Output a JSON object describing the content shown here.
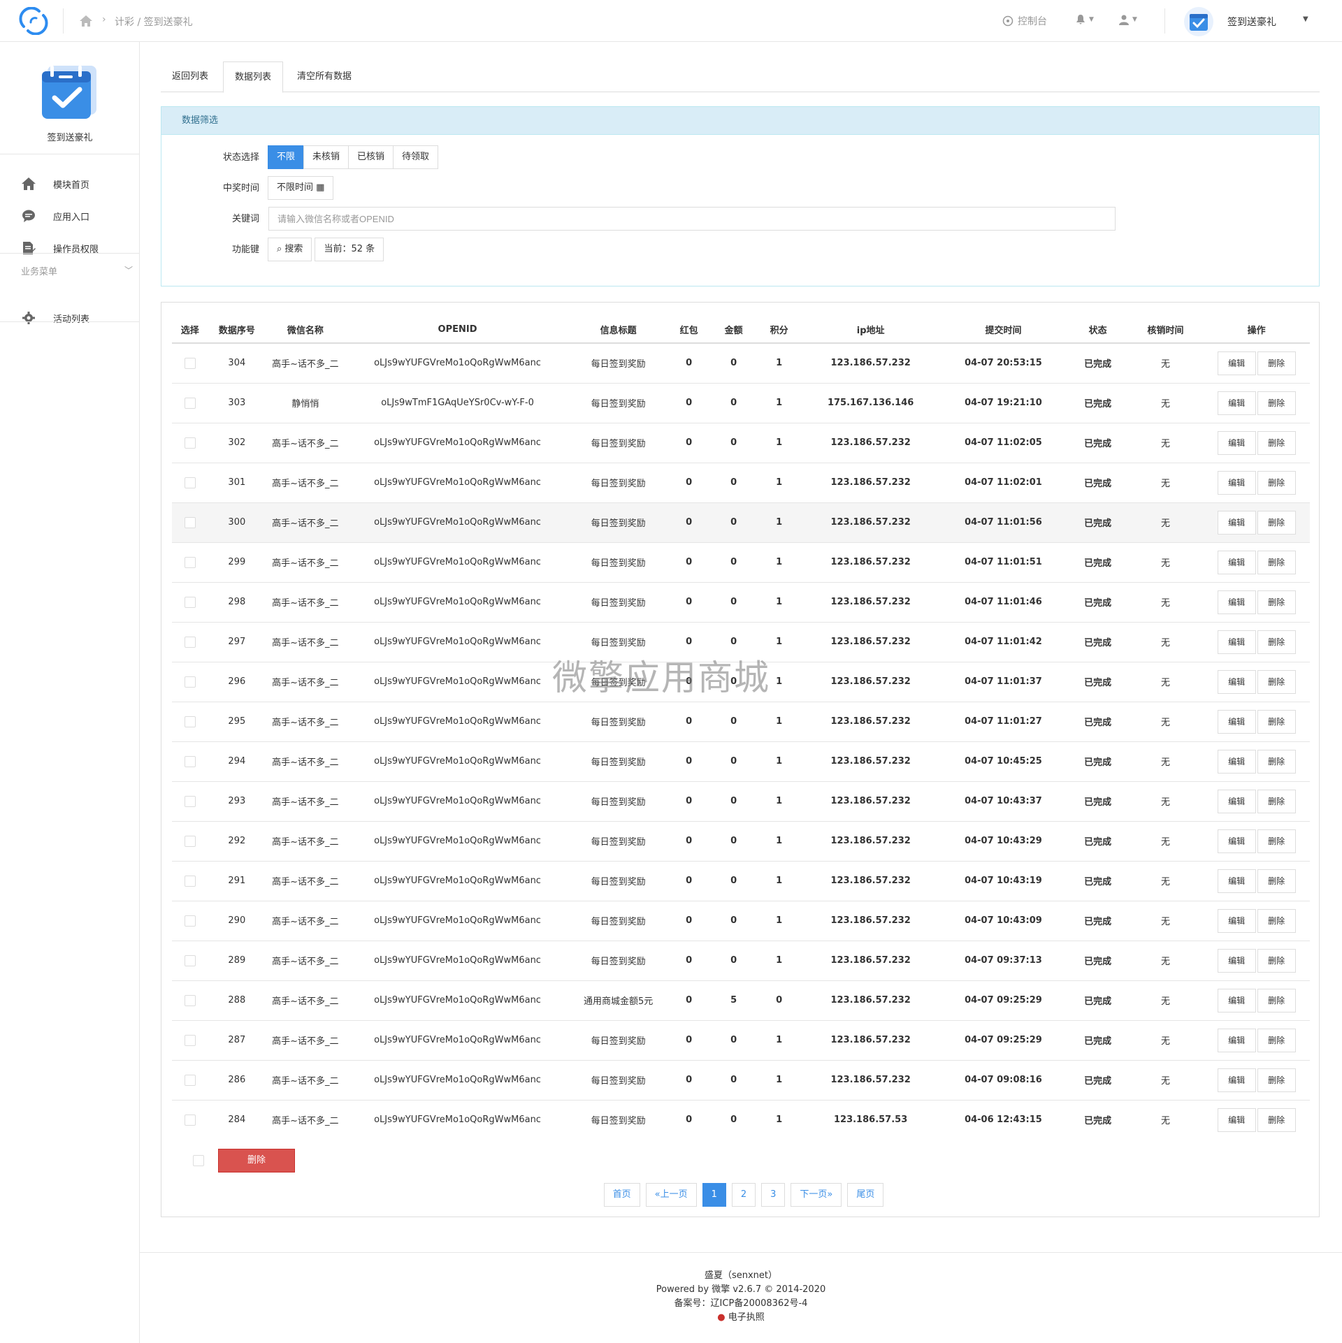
{
  "topbar": {
    "breadcrumb": "计彩 / 签到送豪礼",
    "console_label": "控制台",
    "app_name": "签到送豪礼"
  },
  "sidebar": {
    "app_name": "签到送豪礼",
    "items": [
      {
        "label": "模块首页",
        "icon": "home-icon"
      },
      {
        "label": "应用入口",
        "icon": "chat-icon"
      },
      {
        "label": "操作员权限",
        "icon": "document-edit-icon"
      }
    ],
    "group_label": "业务菜单",
    "group_items": [
      {
        "label": "活动列表",
        "icon": "gear-icon"
      }
    ]
  },
  "tabs": [
    {
      "label": "返回列表",
      "active": false
    },
    {
      "label": "数据列表",
      "active": true
    },
    {
      "label": "清空所有数据",
      "active": false
    }
  ],
  "filter": {
    "title": "数据筛选",
    "status_label": "状态选择",
    "status_options": [
      "不限",
      "未核销",
      "已核销",
      "待领取"
    ],
    "status_selected": "不限",
    "time_label": "中奖时间",
    "time_value": "不限时间",
    "keyword_label": "关键词",
    "keyword_placeholder": "请输入微信名称或者OPENID",
    "func_label": "功能键",
    "search_label": "搜索",
    "count_label": "当前：52 条"
  },
  "table": {
    "headers": [
      "选择",
      "数据序号",
      "微信名称",
      "OPENID",
      "信息标题",
      "红包",
      "金额",
      "积分",
      "ip地址",
      "提交时间",
      "状态",
      "核销时间",
      "操作"
    ],
    "edit_label": "编辑",
    "delete_label": "删除",
    "rows": [
      {
        "id": "304",
        "name": "高手~话不多_二",
        "openid": "oLJs9wYUFGVreMo1oQoRgWwM6anc",
        "title": "每日签到奖励",
        "redpack": "0",
        "amount": "0",
        "points": "1",
        "ip": "123.186.57.232",
        "time": "04-07 20:53:15",
        "status": "已完成",
        "verify_time": "无"
      },
      {
        "id": "303",
        "name": "静悄悄",
        "openid": "oLJs9wTmF1GAqUeYSr0Cv-wY-F-0",
        "title": "每日签到奖励",
        "redpack": "0",
        "amount": "0",
        "points": "1",
        "ip": "175.167.136.146",
        "time": "04-07 19:21:10",
        "status": "已完成",
        "verify_time": "无"
      },
      {
        "id": "302",
        "name": "高手~话不多_二",
        "openid": "oLJs9wYUFGVreMo1oQoRgWwM6anc",
        "title": "每日签到奖励",
        "redpack": "0",
        "amount": "0",
        "points": "1",
        "ip": "123.186.57.232",
        "time": "04-07 11:02:05",
        "status": "已完成",
        "verify_time": "无"
      },
      {
        "id": "301",
        "name": "高手~话不多_二",
        "openid": "oLJs9wYUFGVreMo1oQoRgWwM6anc",
        "title": "每日签到奖励",
        "redpack": "0",
        "amount": "0",
        "points": "1",
        "ip": "123.186.57.232",
        "time": "04-07 11:02:01",
        "status": "已完成",
        "verify_time": "无"
      },
      {
        "id": "300",
        "name": "高手~话不多_二",
        "openid": "oLJs9wYUFGVreMo1oQoRgWwM6anc",
        "title": "每日签到奖励",
        "redpack": "0",
        "amount": "0",
        "points": "1",
        "ip": "123.186.57.232",
        "time": "04-07 11:01:56",
        "status": "已完成",
        "verify_time": "无",
        "highlighted": true
      },
      {
        "id": "299",
        "name": "高手~话不多_二",
        "openid": "oLJs9wYUFGVreMo1oQoRgWwM6anc",
        "title": "每日签到奖励",
        "redpack": "0",
        "amount": "0",
        "points": "1",
        "ip": "123.186.57.232",
        "time": "04-07 11:01:51",
        "status": "已完成",
        "verify_time": "无"
      },
      {
        "id": "298",
        "name": "高手~话不多_二",
        "openid": "oLJs9wYUFGVreMo1oQoRgWwM6anc",
        "title": "每日签到奖励",
        "redpack": "0",
        "amount": "0",
        "points": "1",
        "ip": "123.186.57.232",
        "time": "04-07 11:01:46",
        "status": "已完成",
        "verify_time": "无"
      },
      {
        "id": "297",
        "name": "高手~话不多_二",
        "openid": "oLJs9wYUFGVreMo1oQoRgWwM6anc",
        "title": "每日签到奖励",
        "redpack": "0",
        "amount": "0",
        "points": "1",
        "ip": "123.186.57.232",
        "time": "04-07 11:01:42",
        "status": "已完成",
        "verify_time": "无"
      },
      {
        "id": "296",
        "name": "高手~话不多_二",
        "openid": "oLJs9wYUFGVreMo1oQoRgWwM6anc",
        "title": "每日签到奖励",
        "redpack": "0",
        "amount": "0",
        "points": "1",
        "ip": "123.186.57.232",
        "time": "04-07 11:01:37",
        "status": "已完成",
        "verify_time": "无"
      },
      {
        "id": "295",
        "name": "高手~话不多_二",
        "openid": "oLJs9wYUFGVreMo1oQoRgWwM6anc",
        "title": "每日签到奖励",
        "redpack": "0",
        "amount": "0",
        "points": "1",
        "ip": "123.186.57.232",
        "time": "04-07 11:01:27",
        "status": "已完成",
        "verify_time": "无"
      },
      {
        "id": "294",
        "name": "高手~话不多_二",
        "openid": "oLJs9wYUFGVreMo1oQoRgWwM6anc",
        "title": "每日签到奖励",
        "redpack": "0",
        "amount": "0",
        "points": "1",
        "ip": "123.186.57.232",
        "time": "04-07 10:45:25",
        "status": "已完成",
        "verify_time": "无"
      },
      {
        "id": "293",
        "name": "高手~话不多_二",
        "openid": "oLJs9wYUFGVreMo1oQoRgWwM6anc",
        "title": "每日签到奖励",
        "redpack": "0",
        "amount": "0",
        "points": "1",
        "ip": "123.186.57.232",
        "time": "04-07 10:43:37",
        "status": "已完成",
        "verify_time": "无"
      },
      {
        "id": "292",
        "name": "高手~话不多_二",
        "openid": "oLJs9wYUFGVreMo1oQoRgWwM6anc",
        "title": "每日签到奖励",
        "redpack": "0",
        "amount": "0",
        "points": "1",
        "ip": "123.186.57.232",
        "time": "04-07 10:43:29",
        "status": "已完成",
        "verify_time": "无"
      },
      {
        "id": "291",
        "name": "高手~话不多_二",
        "openid": "oLJs9wYUFGVreMo1oQoRgWwM6anc",
        "title": "每日签到奖励",
        "redpack": "0",
        "amount": "0",
        "points": "1",
        "ip": "123.186.57.232",
        "time": "04-07 10:43:19",
        "status": "已完成",
        "verify_time": "无"
      },
      {
        "id": "290",
        "name": "高手~话不多_二",
        "openid": "oLJs9wYUFGVreMo1oQoRgWwM6anc",
        "title": "每日签到奖励",
        "redpack": "0",
        "amount": "0",
        "points": "1",
        "ip": "123.186.57.232",
        "time": "04-07 10:43:09",
        "status": "已完成",
        "verify_time": "无"
      },
      {
        "id": "289",
        "name": "高手~话不多_二",
        "openid": "oLJs9wYUFGVreMo1oQoRgWwM6anc",
        "title": "每日签到奖励",
        "redpack": "0",
        "amount": "0",
        "points": "1",
        "ip": "123.186.57.232",
        "time": "04-07 09:37:13",
        "status": "已完成",
        "verify_time": "无"
      },
      {
        "id": "288",
        "name": "高手~话不多_二",
        "openid": "oLJs9wYUFGVreMo1oQoRgWwM6anc",
        "title": "通用商城金额5元",
        "redpack": "0",
        "amount": "5",
        "points": "0",
        "ip": "123.186.57.232",
        "time": "04-07 09:25:29",
        "status": "已完成",
        "verify_time": "无"
      },
      {
        "id": "287",
        "name": "高手~话不多_二",
        "openid": "oLJs9wYUFGVreMo1oQoRgWwM6anc",
        "title": "每日签到奖励",
        "redpack": "0",
        "amount": "0",
        "points": "1",
        "ip": "123.186.57.232",
        "time": "04-07 09:25:29",
        "status": "已完成",
        "verify_time": "无"
      },
      {
        "id": "286",
        "name": "高手~话不多_二",
        "openid": "oLJs9wYUFGVreMo1oQoRgWwM6anc",
        "title": "每日签到奖励",
        "redpack": "0",
        "amount": "0",
        "points": "1",
        "ip": "123.186.57.232",
        "time": "04-07 09:08:16",
        "status": "已完成",
        "verify_time": "无"
      },
      {
        "id": "284",
        "name": "高手~话不多_二",
        "openid": "oLJs9wYUFGVreMo1oQoRgWwM6anc",
        "title": "每日签到奖励",
        "redpack": "0",
        "amount": "0",
        "points": "1",
        "ip": "123.186.57.53",
        "time": "04-06 12:43:15",
        "status": "已完成",
        "verify_time": "无"
      }
    ]
  },
  "bulk": {
    "delete_label": "删除"
  },
  "pagination": [
    {
      "label": "首页",
      "active": false
    },
    {
      "label": "«上一页",
      "active": false
    },
    {
      "label": "1",
      "active": true
    },
    {
      "label": "2",
      "active": false
    },
    {
      "label": "3",
      "active": false
    },
    {
      "label": "下一页»",
      "active": false
    },
    {
      "label": "尾页",
      "active": false
    }
  ],
  "watermark": "微擎应用商城",
  "footer": {
    "line1": "盛夏（senxnet）",
    "line2": "Powered by 微擎 v2.6.7 © 2014-2020",
    "line3": "备案号：辽ICP备20008362号-4",
    "line4": "电子执照"
  },
  "colors": {
    "primary": "#3a8ee6",
    "success": "#5cb85c",
    "danger": "#d9534f",
    "panel_head": "#d9edf7"
  }
}
